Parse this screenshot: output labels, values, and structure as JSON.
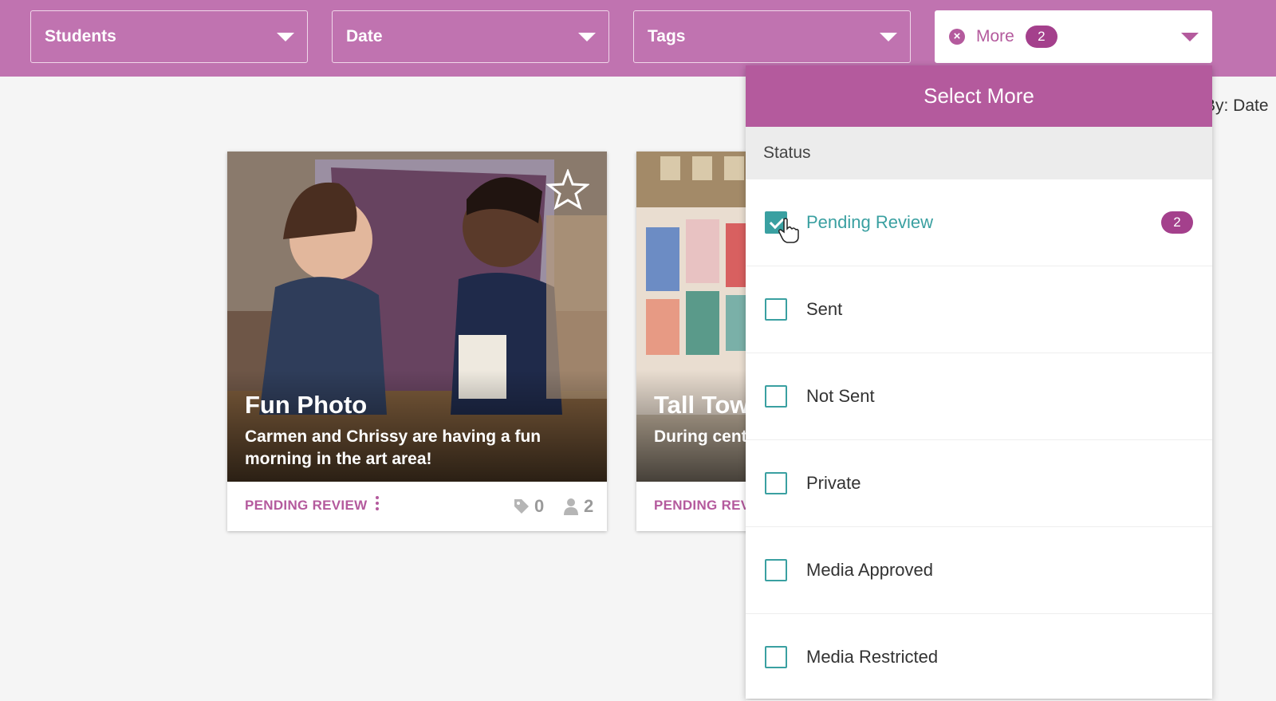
{
  "filters": {
    "students": "Students",
    "date": "Date",
    "tags": "Tags",
    "more": "More",
    "more_count": "2"
  },
  "sort_label": "By: Date",
  "cards": [
    {
      "title": "Fun Photo",
      "description": "Carmen and Chrissy are having a fun morning in the art area!",
      "status": "PENDING REVIEW",
      "tag_count": "0",
      "people_count": "2"
    },
    {
      "title": "Tall Tow",
      "description": "During cent and said, \"L",
      "status": "PENDING REV"
    }
  ],
  "dropdown": {
    "header": "Select More",
    "section": "Status",
    "options": [
      {
        "label": "Pending Review",
        "checked": true,
        "badge": "2"
      },
      {
        "label": "Sent",
        "checked": false
      },
      {
        "label": "Not Sent",
        "checked": false
      },
      {
        "label": "Private",
        "checked": false
      },
      {
        "label": "Media Approved",
        "checked": false
      },
      {
        "label": "Media Restricted",
        "checked": false
      }
    ]
  },
  "colors": {
    "brand": "#c073b0",
    "brand_dark": "#b45a9d",
    "accent": "#3aa0a1"
  },
  "icons": [
    "chevron-down-icon",
    "clear-icon",
    "star-icon",
    "tag-icon",
    "person-icon",
    "more-vertical-icon",
    "checkmark-icon",
    "hand-cursor-icon"
  ]
}
